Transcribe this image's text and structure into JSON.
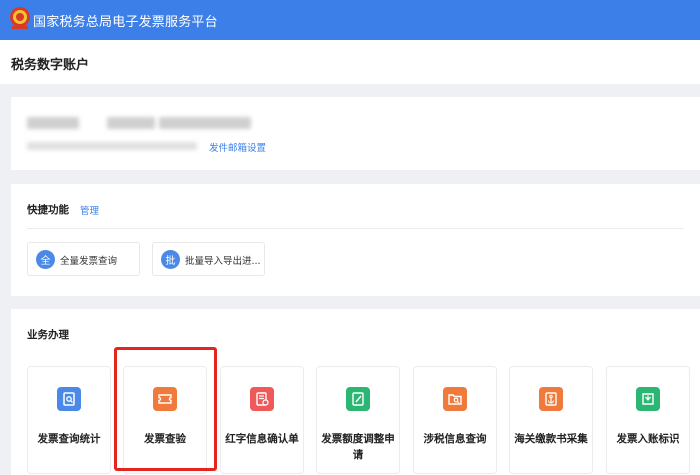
{
  "header": {
    "title": "国家税务总局电子发票服务平台"
  },
  "page": {
    "title": "税务数字账户"
  },
  "account": {
    "mail_settings_label": "发件邮箱设置"
  },
  "quick": {
    "title": "快捷功能",
    "manage_label": "管理",
    "items": [
      {
        "badge": "全",
        "label": "全量发票查询"
      },
      {
        "badge": "批",
        "label": "批量导入导出进..."
      }
    ]
  },
  "business": {
    "title": "业务办理",
    "tiles": [
      {
        "label": "发票查询统计",
        "color": "#4a89e8",
        "icon": "invoice-search-icon"
      },
      {
        "label": "发票查验",
        "color": "#f07a3b",
        "icon": "ticket-icon"
      },
      {
        "label": "红字信息确认单",
        "color": "#ee5a5a",
        "icon": "red-document-icon"
      },
      {
        "label": "发票额度调整申请",
        "color": "#2bb673",
        "icon": "edit-document-icon"
      },
      {
        "label": "涉税信息查询",
        "color": "#f07a3b",
        "icon": "folder-search-icon"
      },
      {
        "label": "海关缴款书采集",
        "color": "#f07a3b",
        "icon": "anchor-icon"
      },
      {
        "label": "发票入账标识",
        "color": "#2bb673",
        "icon": "download-box-icon"
      }
    ]
  },
  "colors": {
    "primary": "#3d7fe8",
    "highlight": "#e3251f"
  }
}
